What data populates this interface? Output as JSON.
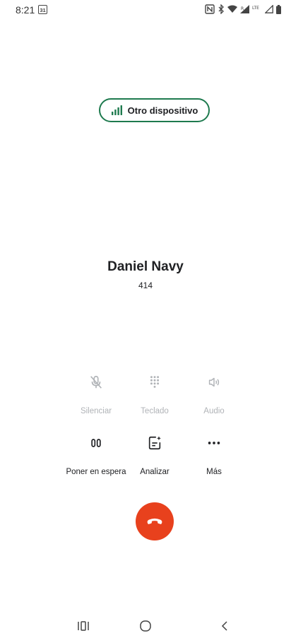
{
  "status_bar": {
    "time": "8:21",
    "calendar_day": "31",
    "lte_label": "LTE"
  },
  "device_pill": {
    "label": "Otro dispositivo",
    "accent_color": "#1e7a4e"
  },
  "contact": {
    "name": "Daniel Navy",
    "number": "414"
  },
  "actions": [
    {
      "label": "Silenciar",
      "icon": "mic-off-icon",
      "enabled": false
    },
    {
      "label": "Teclado",
      "icon": "dialpad-icon",
      "enabled": false
    },
    {
      "label": "Audio",
      "icon": "speaker-icon",
      "enabled": false
    },
    {
      "label": "Poner en espera",
      "icon": "pause-icon",
      "enabled": true
    },
    {
      "label": "Analizar",
      "icon": "analyze-icon",
      "enabled": true
    },
    {
      "label": "Más",
      "icon": "more-icon",
      "enabled": true
    }
  ],
  "end_call": {
    "icon": "end-call-icon",
    "color": "#e8411d"
  },
  "nav": {
    "recents_icon": "recents-icon",
    "home_icon": "home-icon",
    "back_icon": "back-icon"
  }
}
